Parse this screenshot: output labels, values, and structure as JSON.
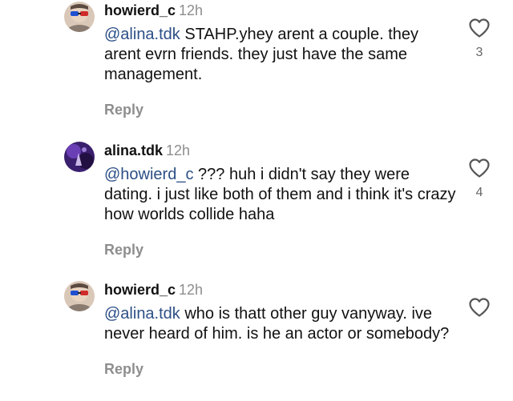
{
  "comments": [
    {
      "username": "howierd_c",
      "time": "12h",
      "mention": "@alina.tdk",
      "body": "STAHP.yhey arent a couple. they arent evrn friends. they just have the same management.",
      "reply_label": "Reply",
      "like_count": "3",
      "avatar_icon": "user-avatar-3d-glasses-icon"
    },
    {
      "username": "alina.tdk",
      "time": "12h",
      "mention": "@howierd_c",
      "body": "??? huh i didn't say they were dating. i just like both of them and i think it's crazy how worlds collide haha",
      "reply_label": "Reply",
      "like_count": "4",
      "avatar_icon": "user-avatar-purple-icon"
    },
    {
      "username": "howierd_c",
      "time": "12h",
      "mention": "@alina.tdk",
      "body": "who is thatt other guy  vanyway. ive never heard of him. is he an actor or somebody?",
      "reply_label": "Reply",
      "like_count": "",
      "avatar_icon": "user-avatar-3d-glasses-icon"
    }
  ],
  "colors": {
    "mention": "#2c4f86",
    "muted": "#8e8e8e",
    "text": "#111111"
  }
}
